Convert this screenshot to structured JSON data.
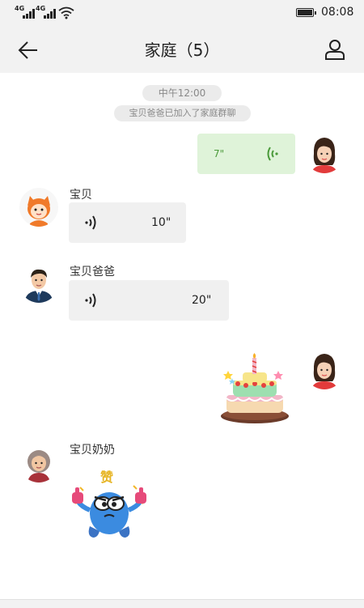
{
  "status_bar": {
    "network_1": "4G",
    "network_2": "4G",
    "time": "08:08"
  },
  "header": {
    "title": "家庭（5）",
    "back_icon": "back-arrow-icon",
    "members_icon": "person-icon"
  },
  "chat": {
    "timestamp": "中午12:00",
    "system_notice": "宝贝爸爸已加入了家庭群聊",
    "messages": [
      {
        "sender": "me",
        "type": "voice",
        "duration": "7\""
      },
      {
        "sender": "宝贝",
        "type": "voice",
        "duration": "10\""
      },
      {
        "sender": "宝贝爸爸",
        "type": "voice",
        "duration": "20\""
      },
      {
        "sender": "me",
        "type": "sticker",
        "sticker": "birthday-cake"
      },
      {
        "sender": "宝贝奶奶",
        "type": "sticker",
        "sticker": "thumbs-up-monster",
        "sticker_text": "赞"
      }
    ]
  },
  "colors": {
    "bar_background": "#f2f2f2",
    "incoming_bubble": "#f0f0f0",
    "outgoing_bubble": "#dff3d9",
    "outgoing_text": "#4a9a3a"
  }
}
